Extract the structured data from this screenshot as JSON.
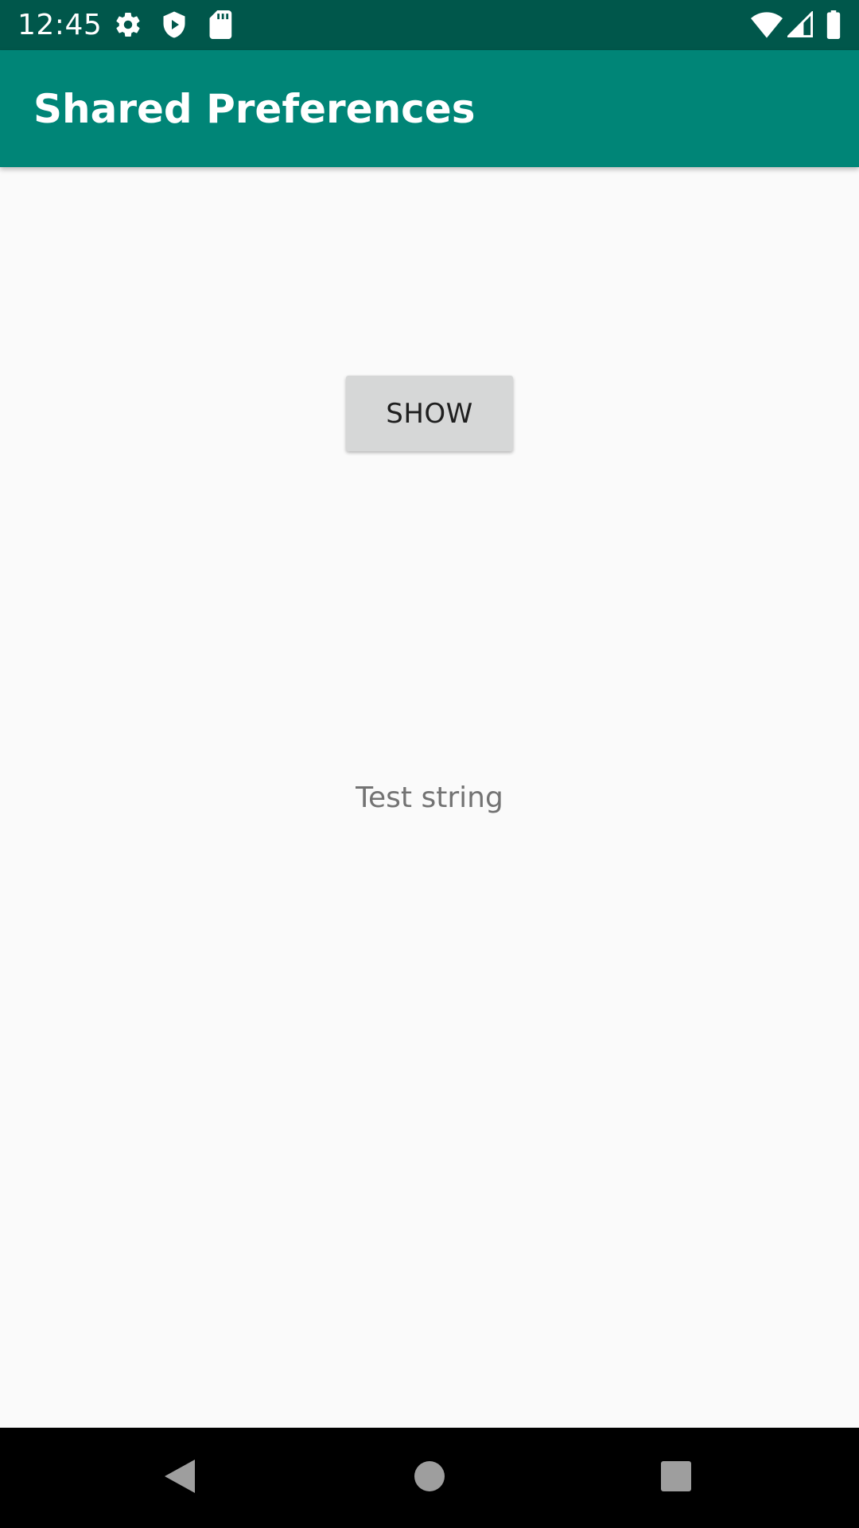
{
  "status_bar": {
    "time": "12:45",
    "left_icons": [
      "gear-icon",
      "shield-play-icon",
      "sd-card-icon"
    ],
    "right_icons": [
      "wifi-icon",
      "cell-signal-icon",
      "battery-icon"
    ]
  },
  "app_bar": {
    "title": "Shared Preferences"
  },
  "content": {
    "show_button_label": "SHOW",
    "result_text": "Test string"
  },
  "nav_bar": {
    "icons": [
      "back-icon",
      "home-icon",
      "recents-icon"
    ]
  },
  "colors": {
    "status_bar": "#00574b",
    "app_bar": "#008577",
    "background": "#fafafa",
    "button": "#d6d7d7",
    "result_text": "#737373",
    "nav_bar": "#000000"
  }
}
